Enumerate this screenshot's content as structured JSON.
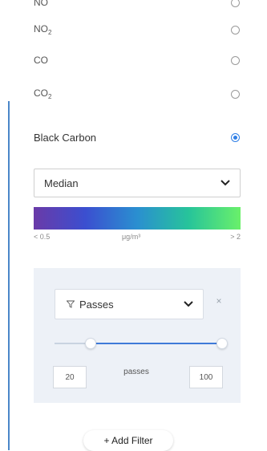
{
  "pollutants": [
    {
      "label": "NO",
      "sub": "",
      "selected": false
    },
    {
      "label": "NO",
      "sub": "2",
      "selected": false
    },
    {
      "label": "CO",
      "sub": "",
      "selected": false
    },
    {
      "label": "CO",
      "sub": "2",
      "selected": false
    }
  ],
  "active_pollutant": {
    "label": "Black Carbon",
    "selected": true
  },
  "statistic_select": {
    "value": "Median"
  },
  "legend": {
    "min_label": "< 0.5",
    "unit_label": "μg/m³",
    "max_label": "> 2",
    "colors": [
      "#6a3aa8",
      "#3b4fd0",
      "#2a8fd0",
      "#27c49a",
      "#6af06a"
    ]
  },
  "filter": {
    "field": "Passes",
    "close_glyph": "×",
    "range_min": "20",
    "range_max": "100",
    "unit": "passes"
  },
  "add_filter_label": "+ Add Filter",
  "accent_color": "#2f7fe6"
}
